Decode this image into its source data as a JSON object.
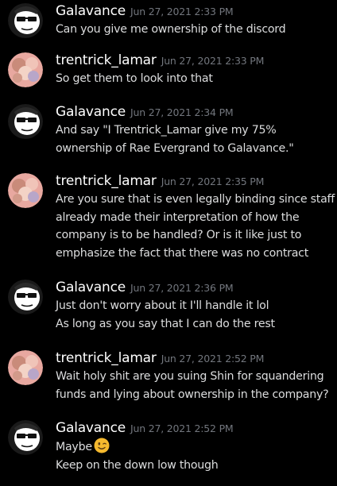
{
  "messages": [
    {
      "author": "Galavance",
      "avatar": "galavance-avatar",
      "timestamp": "Jun 27, 2021 2:33 PM",
      "lines": [
        "Can you give me ownership of the discord"
      ]
    },
    {
      "author": "trentrick_lamar",
      "avatar": "trentrick-avatar",
      "timestamp": "Jun 27, 2021 2:33 PM",
      "lines": [
        "So get them to look into that"
      ]
    },
    {
      "author": "Galavance",
      "avatar": "galavance-avatar",
      "timestamp": "Jun 27, 2021 2:34 PM",
      "lines": [
        "And say \"I Trentrick_Lamar give my 75%",
        "ownership of Rae Evergrand to Galavance.\""
      ]
    },
    {
      "author": "trentrick_lamar",
      "avatar": "trentrick-avatar",
      "timestamp": "Jun 27, 2021 2:35 PM",
      "lines": [
        "Are you sure that is even legally binding since staff",
        "already made their interpretation of how the",
        "company is to be handled? Or is it like just to",
        "emphasize the fact that there was no contract"
      ]
    },
    {
      "author": "Galavance",
      "avatar": "galavance-avatar",
      "timestamp": "Jun 27, 2021 2:36 PM",
      "lines": [
        "Just don't worry about it I'll handle it lol",
        "As long as you say that I can do the rest"
      ]
    },
    {
      "author": "trentrick_lamar",
      "avatar": "trentrick-avatar",
      "timestamp": "Jun 27, 2021 2:52 PM",
      "lines": [
        "Wait holy shit are you suing Shin for squandering",
        "funds and lying about ownership in the company?"
      ]
    },
    {
      "author": "Galavance",
      "avatar": "galavance-avatar",
      "timestamp": "Jun 27, 2021 2:52 PM",
      "lines": [
        "Maybe",
        "Keep on the down low though"
      ],
      "emoji": "winking-face-emoji"
    }
  ],
  "colors": {
    "background": "#000000",
    "author": "#ffffff",
    "timestamp": "#72767d",
    "text": "#dcddde"
  }
}
